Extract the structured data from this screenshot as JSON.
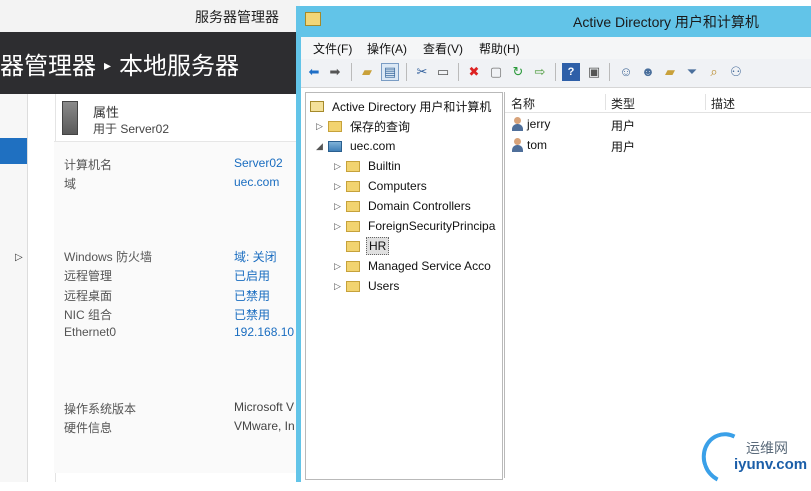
{
  "server_manager": {
    "window_title": "服务器管理器",
    "breadcrumb": {
      "parent": "器管理器",
      "separator": "▸",
      "current": "本地服务器"
    },
    "properties": {
      "title": "属性",
      "subtitle": "用于 Server02"
    },
    "rows": [
      {
        "label": "计算机名",
        "value": "Server02"
      },
      {
        "label": "域",
        "value": "uec.com"
      },
      {
        "label": "Windows 防火墙",
        "value": "域: 关闭"
      },
      {
        "label": "远程管理",
        "value": "已启用"
      },
      {
        "label": "远程桌面",
        "value": "已禁用"
      },
      {
        "label": "NIC 组合",
        "value": "已禁用"
      },
      {
        "label": "Ethernet0",
        "value": "192.168.10"
      },
      {
        "label": "操作系统版本",
        "value": "Microsoft V"
      },
      {
        "label": "硬件信息",
        "value": "VMware, In"
      }
    ]
  },
  "aduc": {
    "title": "Active Directory 用户和计算机",
    "menu": [
      "文件(F)",
      "操作(A)",
      "查看(V)",
      "帮助(H)"
    ],
    "toolbar": [
      "back-icon",
      "forward-icon",
      "up-folder-icon",
      "show-tree-icon",
      "cut-icon",
      "copy-icon",
      "delete-icon",
      "properties-icon",
      "refresh-icon",
      "export-icon",
      "help-icon",
      "console-icon",
      "new-user-icon",
      "new-group-icon",
      "new-ou-icon",
      "filter-icon",
      "find-icon",
      "add-to-group-icon"
    ],
    "tree": {
      "root": "Active Directory 用户和计算机",
      "saved_queries": "保存的查询",
      "domain": "uec.com",
      "children": [
        "Builtin",
        "Computers",
        "Domain Controllers",
        "ForeignSecurityPrincipa",
        "HR",
        "Managed Service Acco",
        "Users"
      ],
      "selected": "HR"
    },
    "list": {
      "columns": [
        "名称",
        "类型",
        "描述"
      ],
      "rows": [
        {
          "name": "jerry",
          "type": "用户"
        },
        {
          "name": "tom",
          "type": "用户"
        }
      ]
    }
  },
  "watermark": {
    "line1": "运维网",
    "line2": "iyunv.com"
  }
}
